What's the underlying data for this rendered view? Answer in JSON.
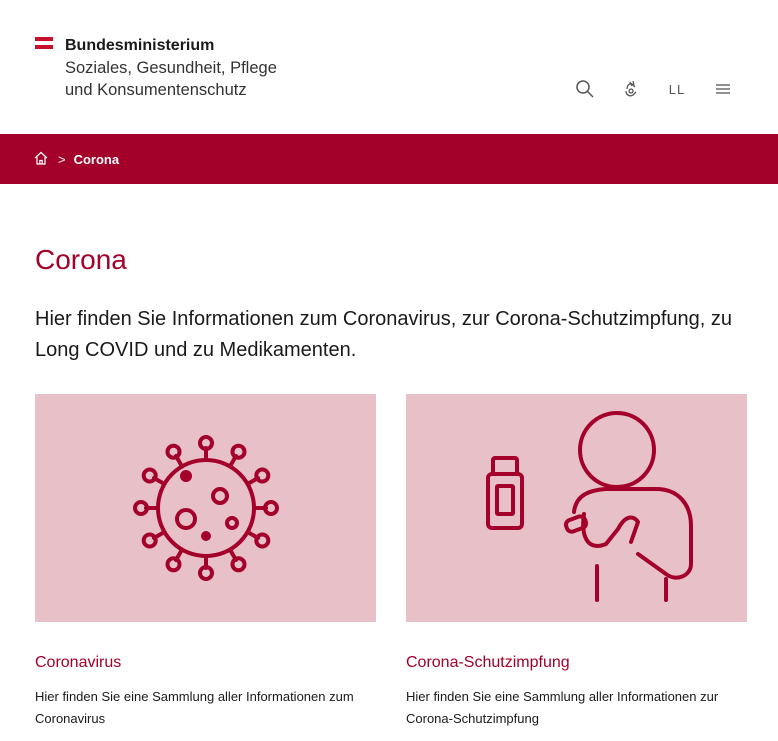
{
  "header": {
    "logo_line1": "Bundesministerium",
    "logo_line2": "Soziales, Gesundheit, Pflege",
    "logo_line3": "und Konsumentenschutz",
    "icons": [
      "search-icon",
      "sign-language-icon",
      "easy-language-icon",
      "menu-icon"
    ],
    "easy_language_label": "LL"
  },
  "breadcrumb": {
    "home_icon": "home-icon",
    "separator": ">",
    "current": "Corona"
  },
  "main": {
    "title": "Corona",
    "lead": "Hier finden Sie Informationen zum Coronavirus, zur Corona-Schutzimpfung, zu Long COVID und zu Medikamenten."
  },
  "cards": [
    {
      "title": "Coronavirus",
      "description": "Hier finden Sie eine Sammlung aller Informationen zum Coronavirus",
      "icon": "virus-icon"
    },
    {
      "title": "Corona-Schutzimpfung",
      "description": "Hier finden Sie eine Sammlung aller Informationen zur Corona-Schutzimpfung",
      "icon": "vaccination-icon"
    }
  ],
  "colors": {
    "brand": "#a3002a",
    "card_bg": "#e8c0c8",
    "flag_red": "#c8102e"
  }
}
